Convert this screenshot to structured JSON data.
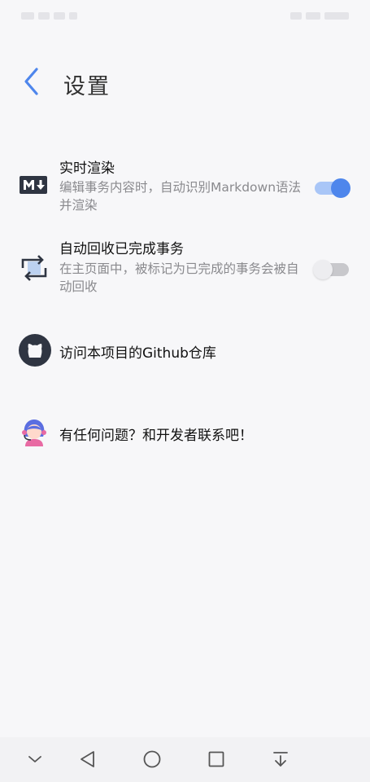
{
  "header": {
    "title": "设置"
  },
  "settings": {
    "markdown": {
      "title": "实时渲染",
      "description": "编辑事务内容时，自动识别Markdown语法并渲染",
      "icon": "markdown-icon",
      "enabled": true
    },
    "auto_recycle": {
      "title": "自动回收已完成事务",
      "description": "在主页面中，被标记为已完成的事务会被自动回收",
      "icon": "recycle-icon",
      "enabled": false
    },
    "github": {
      "title": "访问本项目的Github仓库",
      "icon": "github-icon"
    },
    "contact": {
      "title": "有任何问题？和开发者联系吧！",
      "icon": "support-agent-icon"
    }
  },
  "colors": {
    "accent": "#4e86ec",
    "accent_light": "#a9c6f7",
    "background": "#f7f7f9"
  }
}
